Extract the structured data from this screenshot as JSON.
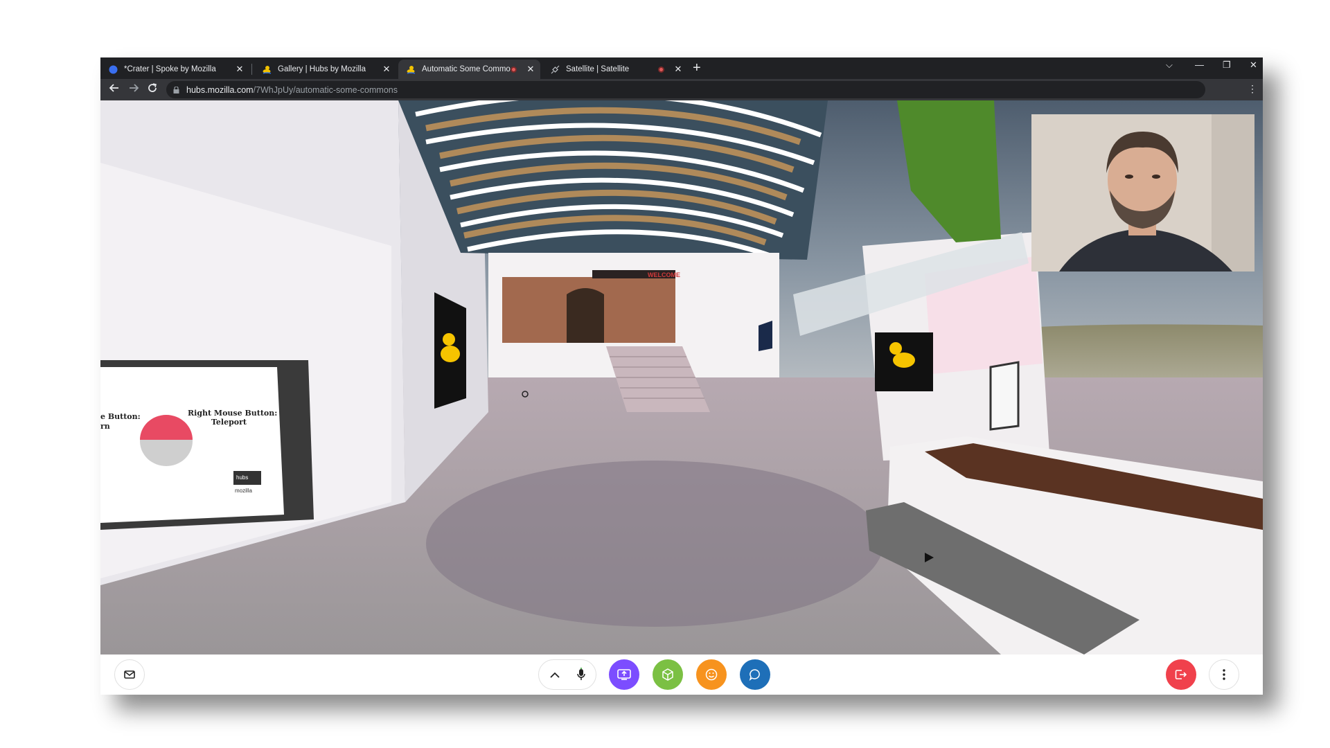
{
  "browser": {
    "tabs": [
      {
        "title": "*Crater | Spoke by Mozilla",
        "favicon": "spoke-icon",
        "recording": false
      },
      {
        "title": "Gallery | Hubs by Mozilla",
        "favicon": "hubs-duck-icon",
        "recording": false
      },
      {
        "title": "Automatic Some Commons |",
        "favicon": "hubs-duck-icon",
        "recording": true,
        "active": true
      },
      {
        "title": "Satellite | Satellite",
        "favicon": "satellite-icon",
        "recording": true
      }
    ],
    "address_bar": {
      "host": "hubs.mozilla.com",
      "path": "/7WhJpUy/automatic-some-commons"
    }
  },
  "scene": {
    "left_sign": {
      "left_label": "e Button:",
      "left_sub": "rn",
      "right_label": "Right Mouse Button:",
      "right_sub": "Teleport",
      "logo_line1": "hubs",
      "logo_line2": "mozilla"
    },
    "welcome_banner": "WELCOME"
  },
  "bottom_bar": {
    "buttons": [
      {
        "name": "invite",
        "icon": "envelope-icon"
      },
      {
        "name": "more-options-toggle",
        "icon": "chevron-up-icon"
      },
      {
        "name": "microphone",
        "icon": "microphone-icon"
      },
      {
        "name": "share-screen",
        "icon": "share-screen-icon",
        "color": "#7c4dff"
      },
      {
        "name": "place-object",
        "icon": "cube-icon",
        "color": "#7bc043"
      },
      {
        "name": "react",
        "icon": "smiley-icon",
        "color": "#f7931e"
      },
      {
        "name": "chat",
        "icon": "chat-bubble-icon",
        "color": "#1e6fb8"
      },
      {
        "name": "leave",
        "icon": "leave-icon",
        "color": "#f0414c"
      },
      {
        "name": "more-menu",
        "icon": "kebab-menu-icon"
      }
    ]
  },
  "colors": {
    "tabbar_bg": "#202124",
    "toolbar_bg": "#35363a",
    "share_purple": "#7c4dff",
    "object_green": "#7bc043",
    "react_orange": "#f7931e",
    "chat_blue": "#1e6fb8",
    "leave_red": "#f0414c"
  }
}
